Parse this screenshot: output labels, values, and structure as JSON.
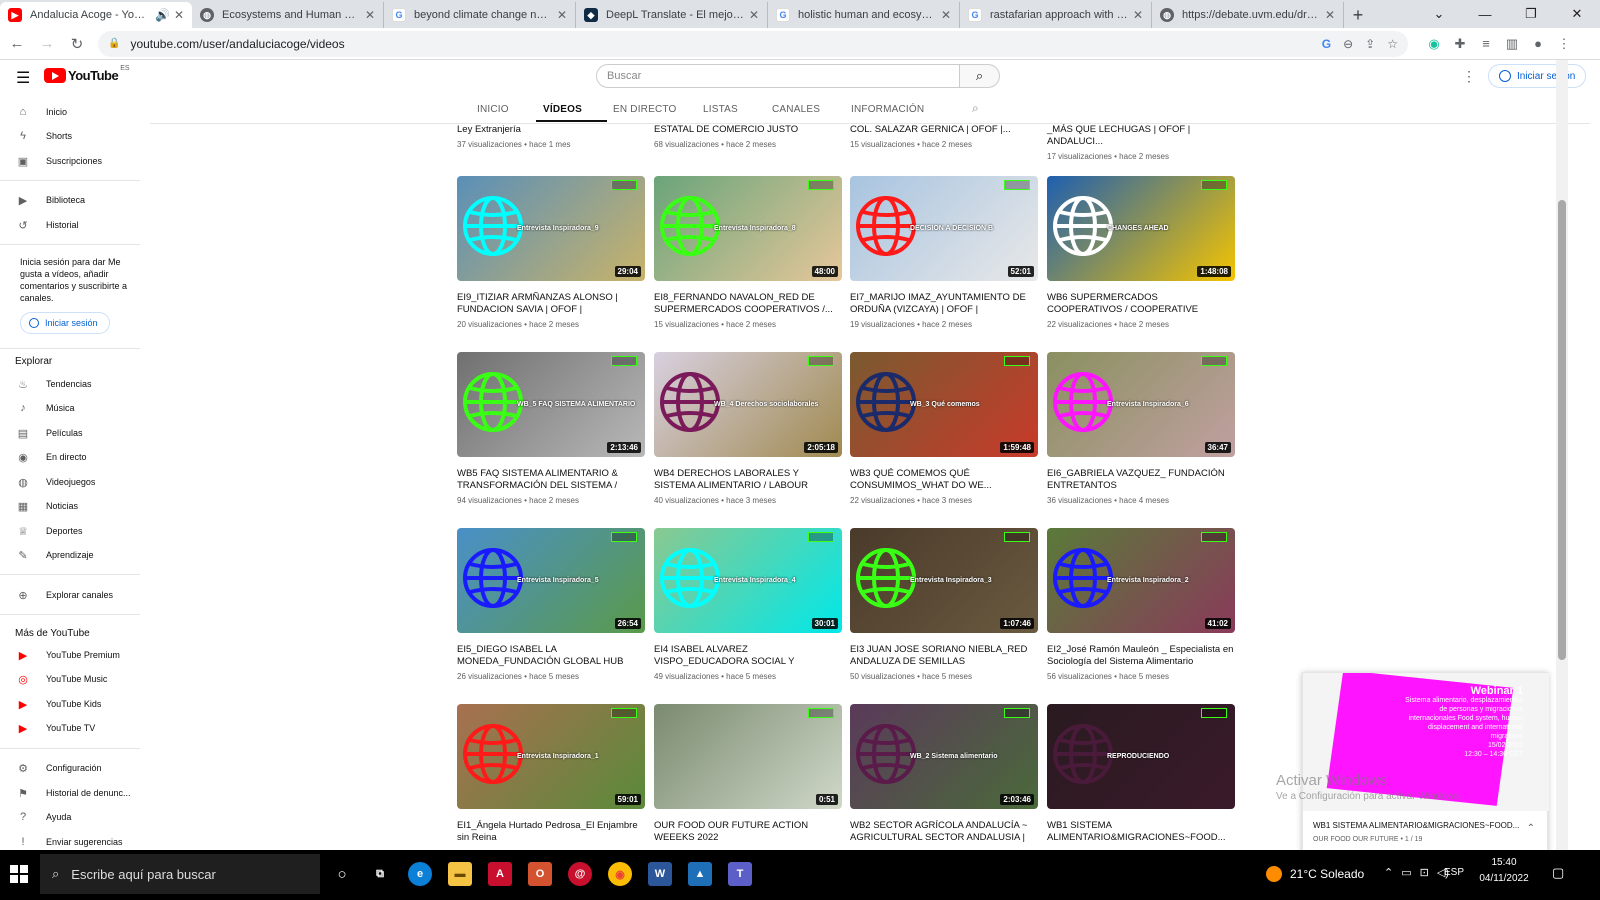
{
  "browser": {
    "tabs": [
      {
        "title": "Andalucia Acoge - YouTube",
        "fav": "youtube",
        "active": true
      },
      {
        "title": "Ecosystems and Human Well-be",
        "fav": "globe"
      },
      {
        "title": "beyond climate change new hu",
        "fav": "google"
      },
      {
        "title": "DeepL Translate - El mejor tradu",
        "fav": "deepl"
      },
      {
        "title": "holistic human and ecosystem",
        "fav": "google"
      },
      {
        "title": "rastafarian approach with nature",
        "fav": "google"
      },
      {
        "title": "https://debate.uvm.edu/dreadlib",
        "fav": "globe"
      }
    ],
    "new_tab": "+",
    "url": "youtube.com/user/andaluciacoge/videos"
  },
  "youtube": {
    "logo_text": "YouTube",
    "country_code": "ES",
    "search_placeholder": "Buscar",
    "signin_label": "Iniciar sesión",
    "channel_tabs": [
      "INICIO",
      "VÍDEOS",
      "EN DIRECTO",
      "LISTAS",
      "CANALES",
      "INFORMACIÓN"
    ]
  },
  "sidebar": {
    "main": [
      {
        "label": "Inicio",
        "icon": "home-icon",
        "glyph": "⌂"
      },
      {
        "label": "Shorts",
        "icon": "shorts-icon",
        "glyph": "ϟ"
      },
      {
        "label": "Suscripciones",
        "icon": "subscriptions-icon",
        "glyph": "▣"
      }
    ],
    "library": [
      {
        "label": "Biblioteca",
        "icon": "library-icon",
        "glyph": "▶"
      },
      {
        "label": "Historial",
        "icon": "history-icon",
        "glyph": "↺"
      }
    ],
    "signin_note": "Inicia sesión para dar Me gusta a vídeos, añadir comentarios y suscribirte a canales.",
    "signin_label": "Iniciar sesión",
    "explore_title": "Explorar",
    "explore": [
      {
        "label": "Tendencias",
        "icon": "trending-icon",
        "glyph": "♨"
      },
      {
        "label": "Música",
        "icon": "music-icon",
        "glyph": "♪"
      },
      {
        "label": "Películas",
        "icon": "movies-icon",
        "glyph": "▤"
      },
      {
        "label": "En directo",
        "icon": "live-icon",
        "glyph": "◉"
      },
      {
        "label": "Videojuegos",
        "icon": "gaming-icon",
        "glyph": "◍"
      },
      {
        "label": "Noticias",
        "icon": "news-icon",
        "glyph": "▦"
      },
      {
        "label": "Deportes",
        "icon": "sports-icon",
        "glyph": "♕"
      },
      {
        "label": "Aprendizaje",
        "icon": "learning-icon",
        "glyph": "✎"
      }
    ],
    "browse_channels": "Explorar canales",
    "more_title": "Más de YouTube",
    "more": [
      {
        "label": "YouTube Premium",
        "icon": "youtube-premium-icon",
        "glyph": "▶"
      },
      {
        "label": "YouTube Music",
        "icon": "youtube-music-icon",
        "glyph": "◎"
      },
      {
        "label": "YouTube Kids",
        "icon": "youtube-kids-icon",
        "glyph": "▶"
      },
      {
        "label": "YouTube TV",
        "icon": "youtube-tv-icon",
        "glyph": "▶"
      }
    ],
    "footer": [
      {
        "label": "Configuración",
        "icon": "settings-icon",
        "glyph": "⚙"
      },
      {
        "label": "Historial de denunc...",
        "icon": "report-flag-icon",
        "glyph": "⚑"
      },
      {
        "label": "Ayuda",
        "icon": "help-icon",
        "glyph": "?"
      },
      {
        "label": "Enviar sugerencias",
        "icon": "feedback-icon",
        "glyph": "!"
      }
    ]
  },
  "top_partial_row": [
    {
      "title": "Ley Extranjería",
      "meta": "37 visualizaciones • hace 1 mes"
    },
    {
      "title": "ESTATAL DE COMERCIO JUSTO",
      "meta": "68 visualizaciones • hace 2 meses"
    },
    {
      "title": "COL. SALAZAR GERNICA | OFOF |...",
      "meta": "15 visualizaciones • hace 2 meses"
    },
    {
      "title": "_MÁS QUE LECHUGAS | OFOF | ANDALUCI...",
      "meta": "17 visualizaciones • hace 2 meses"
    }
  ],
  "videos": [
    {
      "title": "EI9_ITIZIAR ARMÑANZAS ALONSO | FUNDACION SAVIA | OFOF | ANDALUCIA...",
      "meta": "20 visualizaciones • hace 2 meses",
      "duration": "29:04",
      "bg": "#5a8fb8",
      "bg2": "#c8b36a",
      "globe": "#00ffff",
      "overlay": "Entrevista Inspiradora_9"
    },
    {
      "title": "EI8_FERNANDO NAVALON_RED DE SUPERMERCADOS COOPERATIVOS /...",
      "meta": "15 visualizaciones • hace 2 meses",
      "duration": "48:00",
      "bg": "#6aa47a",
      "bg2": "#e6c79a",
      "globe": "#39ff14",
      "overlay": "Entrevista Inspiradora_8"
    },
    {
      "title": "EI7_MARIJO IMAZ_AYUNTAMIENTO DE ORDUÑA (VIZCAYA) | OFOF | ANDALUCIA...",
      "meta": "19 visualizaciones • hace 2 meses",
      "duration": "52:01",
      "bg": "#a8c4e0",
      "bg2": "#e8e8e8",
      "globe": "#ff1a1a",
      "overlay": "DECISION A   DECISION B"
    },
    {
      "title": "WB6 SUPERMERCADOS COOPERATIVOS / COOPERATIVE SUPERMARKETS | OFOF |...",
      "meta": "22 visualizaciones • hace 2 meses",
      "duration": "1:48:08",
      "bg": "#1e5fb0",
      "bg2": "#f5c400",
      "globe": "#ffffff",
      "overlay": "CHANGES AHEAD"
    },
    {
      "title": "WB5 FAQ SISTEMA ALIMENTARIO & TRANSFORMACIÓN DEL SISTEMA / FAQ...",
      "meta": "94 visualizaciones • hace 2 meses",
      "duration": "2:13:46",
      "bg": "#707070",
      "bg2": "#b8b8b8",
      "globe": "#39ff14",
      "overlay": "WB_5 FAQ SISTEMA ALIMENTARIO"
    },
    {
      "title": "WB4 DERECHOS LABORALES Y SISTEMA ALIMENTARIO / LABOUR RIGHTS AND FOO...",
      "meta": "40 visualizaciones • hace 3 meses",
      "duration": "2:05:18",
      "bg": "#d8d0e0",
      "bg2": "#a08a50",
      "globe": "#7a1a5a",
      "overlay": "WB_4 Derechos sociolaborales"
    },
    {
      "title": "WB3 QUÉ COMEMOS QUÉ CONSUMIMOS_WHAT DO WE...",
      "meta": "22 visualizaciones • hace 3 meses",
      "duration": "1:59:48",
      "bg": "#7a5a30",
      "bg2": "#c83a2a",
      "globe": "#1a2a6a",
      "overlay": "WB_3 Qué comemos"
    },
    {
      "title": "EI6_GABRIELA VAZQUEZ_ FUNDACIÓN ENTRETANTOS",
      "meta": "36 visualizaciones • hace 4 meses",
      "duration": "36:47",
      "bg": "#8a9060",
      "bg2": "#c0a0a0",
      "globe": "#ff14ff",
      "overlay": "Entrevista Inspiradora_6"
    },
    {
      "title": "EI5_DIEGO ISABEL LA MONEDA_FUNDACIÓN GLOBAL HUB FOR...",
      "meta": "26 visualizaciones • hace 5 meses",
      "duration": "26:54",
      "bg": "#4a90c8",
      "bg2": "#5a9a4a",
      "globe": "#1a1aff",
      "overlay": "Entrevista Inspiradora_5"
    },
    {
      "title": "EI4 ISABEL ALVAREZ VISPO_EDUCADORA SOCIAL Y AGROECOLOGA",
      "meta": "49 visualizaciones • hace 5 meses",
      "duration": "30:01",
      "bg": "#8ac890",
      "bg2": "#00e8e8",
      "globe": "#00ffff",
      "overlay": "Entrevista Inspiradora_4"
    },
    {
      "title": "EI3 JUAN JOSE SORIANO NIEBLA_RED ANDALUZA DE SEMILLAS",
      "meta": "50 visualizaciones • hace 5 meses",
      "duration": "1:07:46",
      "bg": "#4a3a2a",
      "bg2": "#6a5a40",
      "globe": "#39ff14",
      "overlay": "Entrevista Inspiradora_3"
    },
    {
      "title": "EI2_José Ramón Mauleón _ Especialista en Sociología del Sistema Alimentario",
      "meta": "56 visualizaciones • hace 5 meses",
      "duration": "41:02",
      "bg": "#5a7a3a",
      "bg2": "#8a3a5a",
      "globe": "#1a1aff",
      "overlay": "Entrevista Inspiradora_2"
    },
    {
      "title": "EI1_Ángela Hurtado Pedrosa_El Enjambre sin Reina",
      "meta": "",
      "duration": "59:01",
      "bg": "#a87050",
      "bg2": "#5a8a3a",
      "globe": "#ff1a1a",
      "overlay": "Entrevista Inspiradora_1"
    },
    {
      "title": "OUR FOOD OUR FUTURE ACTION WEEEKS 2022",
      "meta": "",
      "duration": "0:51",
      "bg": "#7a8a70",
      "bg2": "#d0d8c8",
      "globe": "",
      "overlay": ""
    },
    {
      "title": "WB2 SECTOR AGRÍCOLA ANDALUCÍA ~ AGRICULTURAL SECTOR ANDALUSIA | OU...",
      "meta": "",
      "duration": "2:03:46",
      "bg": "#5a3a5a",
      "bg2": "#4a6a3a",
      "globe": "#5a1a4a",
      "overlay": "WB_2 Sistema alimentario"
    },
    {
      "title": "WB1 SISTEMA ALIMENTARIO&MIGRACIONES~FOOD...",
      "meta": "",
      "duration": "",
      "bg": "#2a1a20",
      "bg2": "#3a1a2a",
      "globe": "#4a1a3a",
      "overlay": "REPRODUCIENDO"
    }
  ],
  "miniplayer": {
    "title": "WB1 SISTEMA ALIMENTARIO&MIGRACIONES~FOOD...",
    "subtitle": "OUR FOOD OUR FUTURE • 1 / 19",
    "slide_title": "Webinar 1",
    "slide_body": "Sistema alimentario, desplazamientos de personas y migraciones internacionales Food system, human displacement and international migrations",
    "slide_date": "15/02/2022",
    "slide_time": "12:30 – 14:30 CET"
  },
  "watermark": {
    "line1": "Activar Windows",
    "line2": "Ve a Configuración para activar Windows."
  },
  "taskbar": {
    "search_placeholder": "Escribe aquí para buscar",
    "weather": "21°C  Soleado",
    "language": "ESP",
    "time": "15:40",
    "date": "04/11/2022"
  }
}
